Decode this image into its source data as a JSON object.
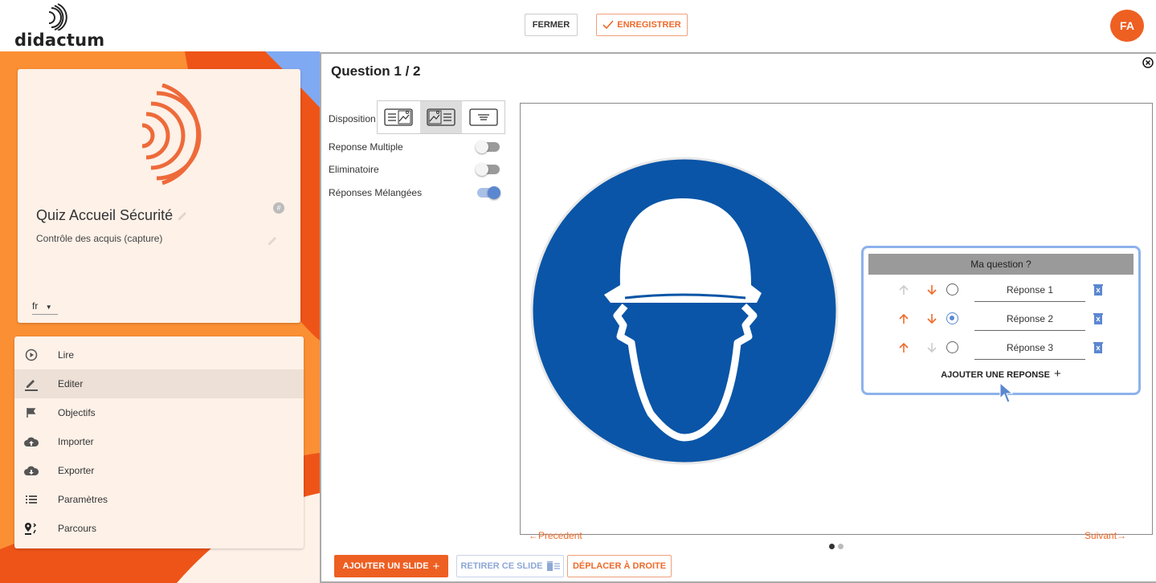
{
  "header": {
    "logo_text": "didactum",
    "close_label": "FERMER",
    "save_label": "ENREGISTRER",
    "avatar_initials": "FA"
  },
  "colors": {
    "accent": "#ee5f22",
    "blue": "#5b87d1",
    "sign_blue": "#0a55a7"
  },
  "quiz": {
    "title": "Quiz Accueil Sécurité",
    "subtitle": "Contrôle des acquis (capture)",
    "language": "fr"
  },
  "menu": {
    "items": [
      {
        "label": "Lire",
        "icon": "play-circle-icon"
      },
      {
        "label": "Editer",
        "icon": "pencil-icon"
      },
      {
        "label": "Objectifs",
        "icon": "flag-icon"
      },
      {
        "label": "Importer",
        "icon": "cloud-upload-icon"
      },
      {
        "label": "Exporter",
        "icon": "cloud-download-icon"
      },
      {
        "label": "Paramètres",
        "icon": "list-icon"
      },
      {
        "label": "Parcours",
        "icon": "route-icon"
      }
    ],
    "active": "Editer"
  },
  "editor": {
    "question_title": "Question 1 / 2",
    "disposition_label": "Disposition",
    "options": {
      "multiple": {
        "label": "Reponse Multiple",
        "on": false
      },
      "eliminatory": {
        "label": "Eliminatoire",
        "on": false
      },
      "shuffled": {
        "label": "Réponses Mélangées",
        "on": true
      }
    }
  },
  "slide": {
    "question": "Ma question ?",
    "answers": [
      "Réponse 1",
      "Réponse 2",
      "Réponse 3"
    ],
    "selected_answer": "Réponse 2",
    "add_answer_label": "AJOUTER UNE REPONSE",
    "prev_label": "Precedent",
    "next_label": "Suivant"
  },
  "footer": {
    "add_slide": "AJOUTER UN SLIDE",
    "remove_slide": "RETIRER CE SLIDE",
    "move_right": "DÉPLACER À DROITE"
  }
}
